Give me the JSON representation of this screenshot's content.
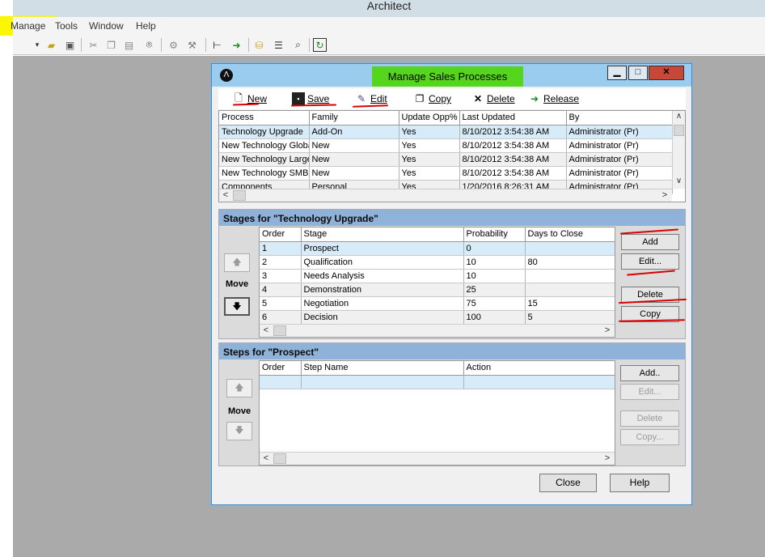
{
  "app": {
    "title": "Architect"
  },
  "menu": [
    "Manage",
    "Tools",
    "Window",
    "Help"
  ],
  "dialog": {
    "title": "Manage Sales Processes",
    "toolbar": {
      "new": "New",
      "save": "Save",
      "edit": "Edit",
      "copy": "Copy",
      "delete": "Delete",
      "release": "Release"
    },
    "processes": {
      "columns": [
        "Process",
        "Family",
        "Update Opp%",
        "Last Updated",
        "By"
      ],
      "rows": [
        [
          "Technology Upgrade",
          "Add-On",
          "Yes",
          "8/10/2012 3:54:38 AM",
          "Administrator (Pr)"
        ],
        [
          "New Technology Globa",
          "New",
          "Yes",
          "8/10/2012 3:54:38 AM",
          "Administrator (Pr)"
        ],
        [
          "New Technology Large",
          "New",
          "Yes",
          "8/10/2012 3:54:38 AM",
          "Administrator (Pr)"
        ],
        [
          "New Technology SMB",
          "New",
          "Yes",
          "8/10/2012 3:54:38 AM",
          "Administrator (Pr)"
        ],
        [
          "Components",
          "Personal",
          "Yes",
          "1/20/2016 8:26:31 AM",
          "Administrator (Pr)"
        ]
      ]
    },
    "stages": {
      "heading": "Stages for \"Technology Upgrade\"",
      "move": "Move",
      "columns": [
        "Order",
        "Stage",
        "Probability",
        "Days to Close"
      ],
      "rows": [
        [
          "1",
          "Prospect",
          "0",
          ""
        ],
        [
          "2",
          "Qualification",
          "10",
          "80"
        ],
        [
          "3",
          "Needs Analysis",
          "10",
          ""
        ],
        [
          "4",
          "Demonstration",
          "25",
          ""
        ],
        [
          "5",
          "Negotiation",
          "75",
          "15"
        ],
        [
          "6",
          "Decision",
          "100",
          "5"
        ]
      ],
      "buttons": {
        "add": "Add",
        "edit": "Edit...",
        "delete": "Delete",
        "copy": "Copy"
      }
    },
    "steps": {
      "heading": "Steps for \"Prospect\"",
      "move": "Move",
      "columns": [
        "Order",
        "Step Name",
        "Action"
      ],
      "buttons": {
        "add": "Add..",
        "edit": "Edit...",
        "delete": "Delete",
        "copy": "Copy..."
      }
    },
    "footer": {
      "close": "Close",
      "help": "Help"
    }
  },
  "colors": {
    "highlight_yellow": "#fbf700",
    "highlight_green": "#55d51b",
    "annotation_red": "#d80000",
    "panel_header": "#8fb2d8",
    "workspace": "#aaaaaa"
  }
}
